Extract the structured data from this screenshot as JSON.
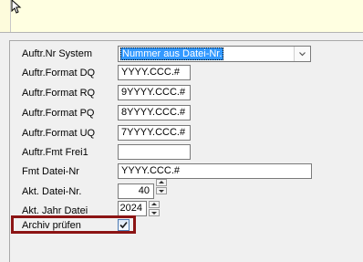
{
  "form": {
    "nr_system": {
      "label": "Auftr.Nr System",
      "value": "Nummer aus Datei-Nr."
    },
    "format_dq": {
      "label": "Auftr.Format DQ",
      "value": "YYYY.CCC.#"
    },
    "format_rq": {
      "label": "Auftr.Format RQ",
      "value": "9YYYY.CCC.#"
    },
    "format_pq": {
      "label": "Auftr.Format PQ",
      "value": "8YYYY.CCC.#"
    },
    "format_uq": {
      "label": "Auftr.Format UQ",
      "value": "7YYYY.CCC.#"
    },
    "fmt_frei1": {
      "label": "Auftr.Fmt Frei1",
      "value": ""
    },
    "fmt_datei_nr": {
      "label": "Fmt Datei-Nr",
      "value": "YYYY.CCC.#"
    },
    "akt_datei_nr": {
      "label": "Akt. Datei-Nr.",
      "value": "40"
    },
    "akt_jahr_datei": {
      "label": "Akt. Jahr Datei",
      "value": "2024"
    },
    "archiv_pruefen": {
      "label": "Archiv prüfen",
      "checked": true
    }
  },
  "colors": {
    "note_background": "#ffffe1",
    "highlight_border": "#8c1414",
    "selection": "#3399ff"
  },
  "icons": [
    "mouse-cursor-icon",
    "chevron-down-icon",
    "spin-up-icon",
    "spin-down-icon",
    "checkmark-icon"
  ]
}
